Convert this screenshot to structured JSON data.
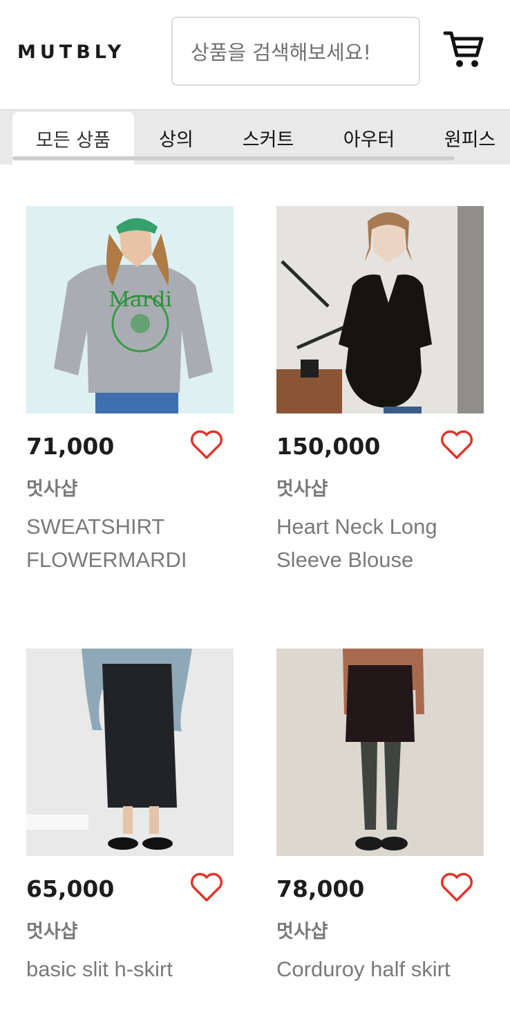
{
  "header": {
    "logo": "MUTBLY",
    "search_placeholder": "상품을 검색해보세요!",
    "cart_icon": "cart-icon"
  },
  "tabs": [
    {
      "label": "모든 상품",
      "active": true
    },
    {
      "label": "상의",
      "active": false
    },
    {
      "label": "스커트",
      "active": false
    },
    {
      "label": "아우터",
      "active": false
    },
    {
      "label": "원피스",
      "active": false
    }
  ],
  "products": [
    {
      "price": "71,000",
      "brand": "멋사샵",
      "name": "SWEATSHIRT FLOWERMARDI",
      "image": "gray-sweatshirt-photo"
    },
    {
      "price": "150,000",
      "brand": "멋사샵",
      "name": "Heart Neck Long Sleeve Blouse",
      "image": "black-blouse-photo"
    },
    {
      "price": "65,000",
      "brand": "멋사샵",
      "name": "basic slit h-skirt",
      "image": "black-long-skirt-photo"
    },
    {
      "price": "78,000",
      "brand": "멋사샵",
      "name": "Corduroy half skirt",
      "image": "corduroy-skirt-photo"
    }
  ],
  "colors": {
    "heart": "#e0352b",
    "tab_bar_bg": "#e9e9e9",
    "brand_text": "#7a7a7a"
  }
}
